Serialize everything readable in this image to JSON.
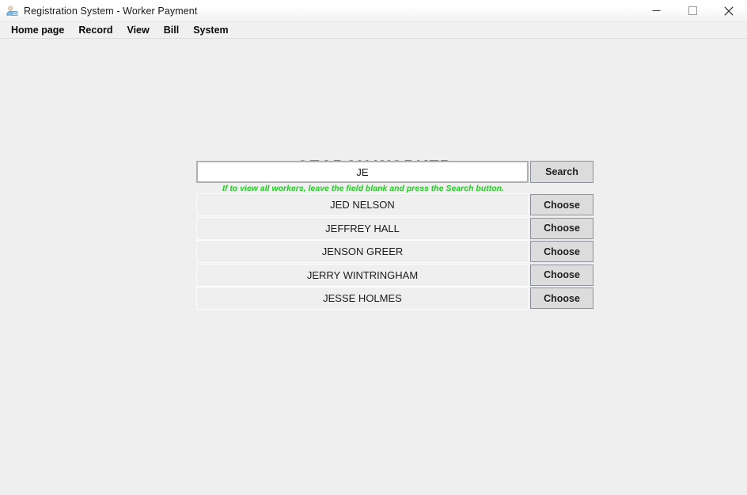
{
  "window": {
    "title": "Registration System - Worker Payment",
    "icon": "worker-user-icon",
    "controls": {
      "minimize": "minimize-icon",
      "maximize": "maximize-icon",
      "close": "close-icon"
    }
  },
  "menubar": {
    "items": [
      {
        "label": "Home page"
      },
      {
        "label": "Record"
      },
      {
        "label": "View"
      },
      {
        "label": "Bill"
      },
      {
        "label": "System"
      }
    ]
  },
  "main": {
    "heading": "SEARCH WORKER",
    "search": {
      "value": "JE",
      "placeholder": "",
      "button_label": "Search",
      "hint": "If to view all workers, leave the field blank and press the Search button.",
      "hint_color": "#22cc22"
    },
    "results": {
      "choose_label": "Choose",
      "rows": [
        {
          "name": "JED NELSON",
          "action": "Choose"
        },
        {
          "name": "JEFFREY HALL",
          "action": "Choose"
        },
        {
          "name": "JENSON GREER",
          "action": "Choose"
        },
        {
          "name": "JERRY WINTRINGHAM",
          "action": "Choose"
        },
        {
          "name": "JESSE HOLMES",
          "action": "Choose"
        }
      ]
    }
  },
  "theme": {
    "background": "#efefef",
    "button_face": "#dcdcdc",
    "button_border": "#8c8f9c",
    "input_border": "#b0b0b0",
    "text": "#1c1c1c"
  }
}
